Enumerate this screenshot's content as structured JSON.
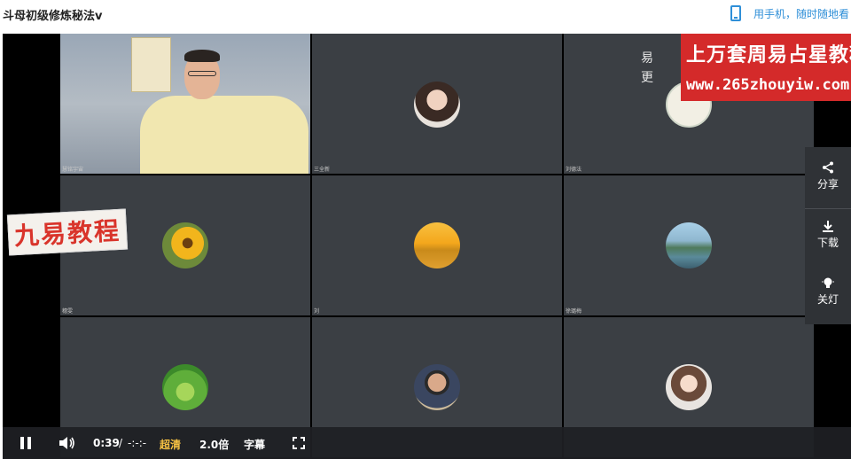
{
  "page": {
    "title": "斗母初级修炼秘法v",
    "mobile_label": "用手机，随时随地看"
  },
  "overlay": {
    "brand_line1": "上万套周易占星教程",
    "brand_line2": "www.265zhouyiw.com",
    "side_text": [
      "易",
      "更"
    ],
    "watermark": "九易教程"
  },
  "tiles": [
    {
      "name": "慧铭宇宙",
      "type": "presenter"
    },
    {
      "name": "三全新",
      "avatar": "woman-portrait"
    },
    {
      "name": "刘德法",
      "avatar": "calligraphy-logo"
    },
    {
      "name": "穗雯",
      "avatar": "sunflower"
    },
    {
      "name": "刘",
      "avatar": "wheat-field"
    },
    {
      "name": "徐璐梅",
      "avatar": "landscape"
    },
    {
      "name": "",
      "avatar": "green-sprout"
    },
    {
      "name": "",
      "avatar": "man-portrait"
    },
    {
      "name": "",
      "avatar": "cartoon-girl"
    }
  ],
  "side_panel": {
    "share": "分享",
    "download": "下载",
    "lights_off": "关灯"
  },
  "controls": {
    "current_time": "0:39",
    "separator": "/",
    "duration": "-:-:-",
    "quality": "超清",
    "speed": "2.0倍",
    "subtitles": "字幕"
  },
  "colors": {
    "accent_blue": "#2f8fd8",
    "quality_gold": "#f6c143",
    "brand_red": "#d42a2a",
    "tile_bg": "#3b3f44"
  }
}
